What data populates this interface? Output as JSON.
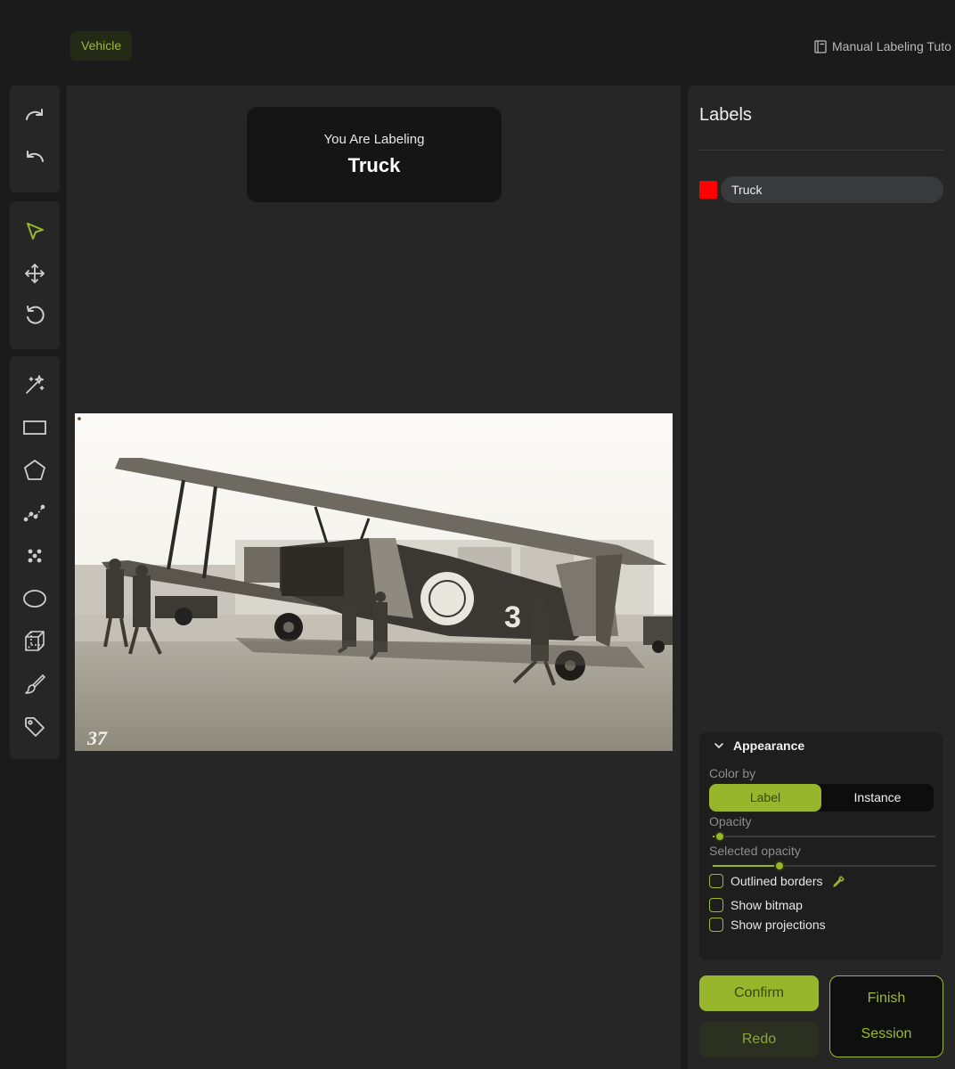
{
  "header": {
    "category": "Vehicle",
    "tutorial_link": "Manual Labeling Tuto",
    "tutorial_icon": "book-icon"
  },
  "toolbar": {
    "history": [
      {
        "name": "redo-icon"
      },
      {
        "name": "undo-icon"
      }
    ],
    "navigation": [
      {
        "name": "select-cursor-icon",
        "active": true
      },
      {
        "name": "move-arrows-icon"
      },
      {
        "name": "rotate-reset-icon"
      }
    ],
    "drawing": [
      {
        "name": "magic-wand-icon"
      },
      {
        "name": "rectangle-icon"
      },
      {
        "name": "polygon-icon"
      },
      {
        "name": "polyline-icon"
      },
      {
        "name": "points-icon"
      },
      {
        "name": "ellipse-icon"
      },
      {
        "name": "cuboid-icon"
      },
      {
        "name": "brush-icon"
      },
      {
        "name": "tag-icon"
      }
    ]
  },
  "canvas": {
    "prompt_caption": "You Are Labeling",
    "prompt_label": "Truck",
    "photo_stamp": "37"
  },
  "labels_panel": {
    "title": "Labels",
    "items": [
      {
        "name": "Truck",
        "color": "#ff0000"
      }
    ]
  },
  "appearance": {
    "title": "Appearance",
    "color_by_label": "Color by",
    "color_by_options": [
      "Label",
      "Instance"
    ],
    "color_by_selected": "Label",
    "opacity_label": "Opacity",
    "opacity_value": 0.03,
    "selected_opacity_label": "Selected opacity",
    "selected_opacity_value": 0.3,
    "checkboxes": [
      {
        "label": "Outlined borders",
        "checked": false,
        "icon": "eyedropper-icon"
      },
      {
        "label": "Show bitmap",
        "checked": false
      },
      {
        "label": "Show projections",
        "checked": false
      }
    ]
  },
  "actions": {
    "confirm": "Confirm",
    "redo": "Redo",
    "finish_line1": "Finish",
    "finish_line2": "Session"
  },
  "colors": {
    "accent": "#98b62c",
    "background": "#1b1b1c",
    "panel": "#262627",
    "label_truck": "#ff0000"
  }
}
